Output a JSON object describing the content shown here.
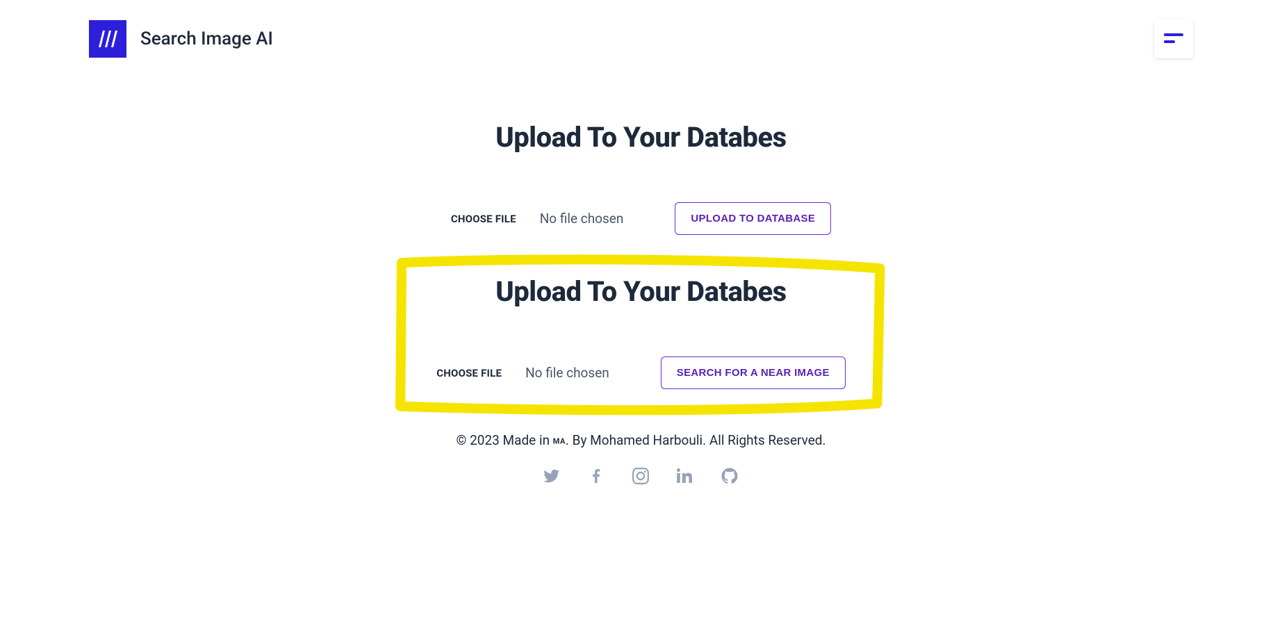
{
  "header": {
    "brand_title": "Search Image AI"
  },
  "section1": {
    "title": "Upload To Your Databes",
    "choose_label": "CHOOSE FILE",
    "file_status": "No file chosen",
    "action_label": "UPLOAD TO DATABASE"
  },
  "section2": {
    "title": "Upload To Your Databes",
    "choose_label": "CHOOSE FILE",
    "file_status": "No file chosen",
    "action_label": "SEARCH FOR A NEAR IMAGE"
  },
  "footer": {
    "copyright_prefix": "© 2023 Made in ",
    "flag": "MA",
    "copyright_suffix": ". By Mohamed Harbouli. All Rights Reserved."
  }
}
